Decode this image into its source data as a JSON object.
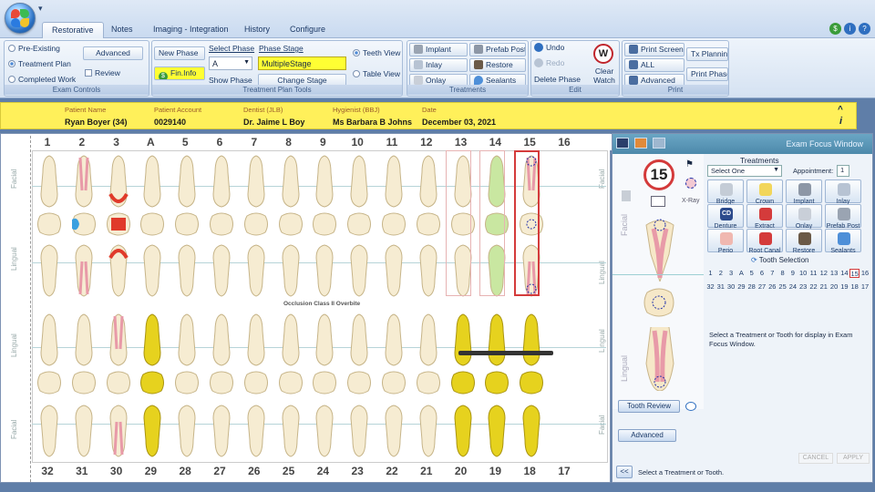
{
  "tabs": [
    "Restorative",
    "Notes",
    "Imaging - Integration",
    "History",
    "Configure"
  ],
  "quick_access": "▾",
  "exam_controls": {
    "label": "Exam Controls",
    "radios": [
      "Pre-Existing",
      "Treatment Plan",
      "Completed Work"
    ],
    "advanced": "Advanced",
    "review": "Review"
  },
  "plan_tools": {
    "label": "Treatment Plan Tools",
    "new_phase": "New Phase",
    "fin_info": "Fin.Info",
    "select_phase": "Select Phase",
    "phase_value": "A",
    "show_phase": "Show Phase",
    "phase_stage": "Phase Stage",
    "stage_value": "MultipleStage",
    "change_stage": "Change Stage",
    "teeth_view": "Teeth View",
    "table_view": "Table View"
  },
  "treatments_group": {
    "label": "Treatments",
    "items": [
      "Implant",
      "Prefab Post",
      "Inlay",
      "Restore",
      "Onlay",
      "Sealants"
    ]
  },
  "edit_group": {
    "label": "Edit",
    "undo": "Undo",
    "redo": "Redo",
    "delete_phase": "Delete Phase",
    "clear_watch": "Clear Watch",
    "watch_letter": "W"
  },
  "print_group": {
    "label": "Print",
    "print_screen": "Print Screen",
    "all": "ALL",
    "advanced": "Advanced",
    "tx_planning": "Tx Planning",
    "print_phase": "Print Phase"
  },
  "patient": {
    "name_label": "Patient Name",
    "name": "Ryan Boyer (34)",
    "account_label": "Patient Account",
    "account": "0029140",
    "dentist_label": "Dentist (JLB)",
    "dentist": "Dr. Jaime L Boy",
    "hygienist_label": "Hygienist (BBJ)",
    "hygienist": "Ms Barbara B Johns",
    "date_label": "Date",
    "date": "December 03, 2021"
  },
  "chart": {
    "top_numbers": [
      "1",
      "2",
      "3",
      "A",
      "5",
      "6",
      "7",
      "8",
      "9",
      "10",
      "11",
      "12",
      "13",
      "14",
      "15",
      "16"
    ],
    "bottom_numbers": [
      "32",
      "31",
      "30",
      "29",
      "28",
      "27",
      "26",
      "25",
      "24",
      "23",
      "22",
      "21",
      "20",
      "19",
      "18",
      "17"
    ],
    "facial": "Facial",
    "lingual": "Lingual",
    "occlusion": "Occlusion Class II Overbite"
  },
  "exam_focus": {
    "title": "Exam Focus Window",
    "tooth_number": "15",
    "xray": "X-Ray",
    "facial": "Facial",
    "lingual": "Lingual",
    "treatments_label": "Treatments",
    "select_one": "Select One",
    "appointment_label": "Appointment:",
    "appointment_value": "1",
    "buttons": [
      "Bridge",
      "Crown",
      "Implant",
      "Inlay",
      "Denture",
      "Extract",
      "Onlay",
      "Prefab Post",
      "Perio",
      "Root Canal",
      "Restore",
      "Sealants"
    ],
    "denture_code": "CD",
    "tooth_selection_label": "Tooth Selection",
    "upper_teeth": [
      "1",
      "2",
      "3",
      "A",
      "5",
      "6",
      "7",
      "8",
      "9",
      "10",
      "11",
      "12",
      "13",
      "14",
      "15",
      "16"
    ],
    "lower_teeth": [
      "32",
      "31",
      "30",
      "29",
      "28",
      "27",
      "26",
      "25",
      "24",
      "23",
      "22",
      "21",
      "20",
      "19",
      "18",
      "17"
    ],
    "selected_tooth": "15",
    "message": "Select a Treatment or Tooth for display in Exam Focus Window.",
    "tooth_review": "Tooth Review",
    "advanced": "Advanced",
    "cancel": "CANCEL",
    "apply": "APPLY",
    "back": "<<",
    "status": "Select a Treatment or Tooth."
  },
  "colors": {
    "patient_bar": "#fff05a",
    "ribbon": "#dce7f4",
    "selected_outline": "#d43b3b",
    "phase_stage_field": "#ffff33",
    "gold": "#d8c21e"
  }
}
